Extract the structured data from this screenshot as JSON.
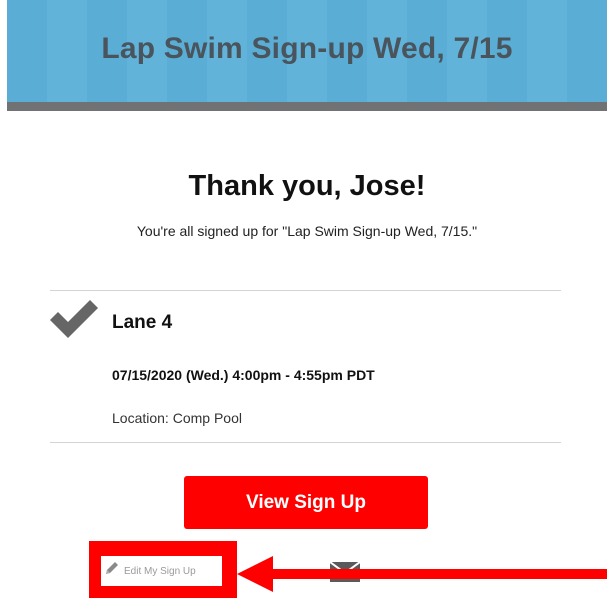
{
  "header": {
    "title": "Lap Swim Sign-up Wed, 7/15"
  },
  "confirmation": {
    "title": "Thank you, Jose!",
    "message": "You're all signed up for \"Lap Swim Sign-up Wed, 7/15.\""
  },
  "slot": {
    "icon": "checkmark-icon",
    "name": "Lane 4",
    "datetime": "07/15/2020 (Wed.) 4:00pm - 4:55pm PDT",
    "location": "Location: Comp Pool"
  },
  "actions": {
    "view_label": "View Sign Up",
    "edit_label": "Edit My Sign Up",
    "edit_icon": "pencil-icon",
    "email_icon": "envelope-icon"
  },
  "colors": {
    "banner": "#5aaed6",
    "banner_text": "#4a545c",
    "primary_button": "#ff0000",
    "annotation": "#ff0000"
  }
}
